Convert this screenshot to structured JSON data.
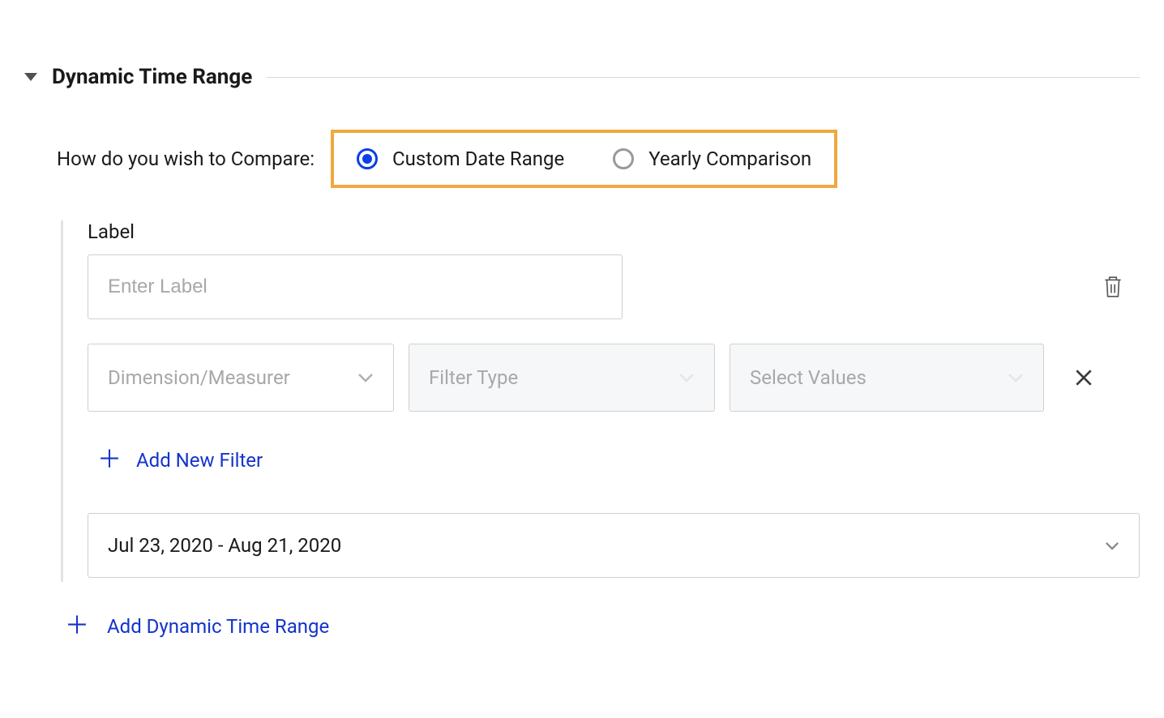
{
  "section": {
    "title": "Dynamic Time Range"
  },
  "compare": {
    "label": "How do you wish to Compare:",
    "options": {
      "custom": "Custom Date Range",
      "yearly": "Yearly Comparison"
    }
  },
  "labelField": {
    "caption": "Label",
    "placeholder": "Enter Label"
  },
  "filterRow": {
    "dimension": "Dimension/Measurer",
    "filterType": "Filter Type",
    "selectValues": "Select Values"
  },
  "actions": {
    "addFilter": "Add New Filter",
    "addDynamic": "Add Dynamic Time Range"
  },
  "dateRange": {
    "value": "Jul 23, 2020 - Aug 21, 2020"
  }
}
